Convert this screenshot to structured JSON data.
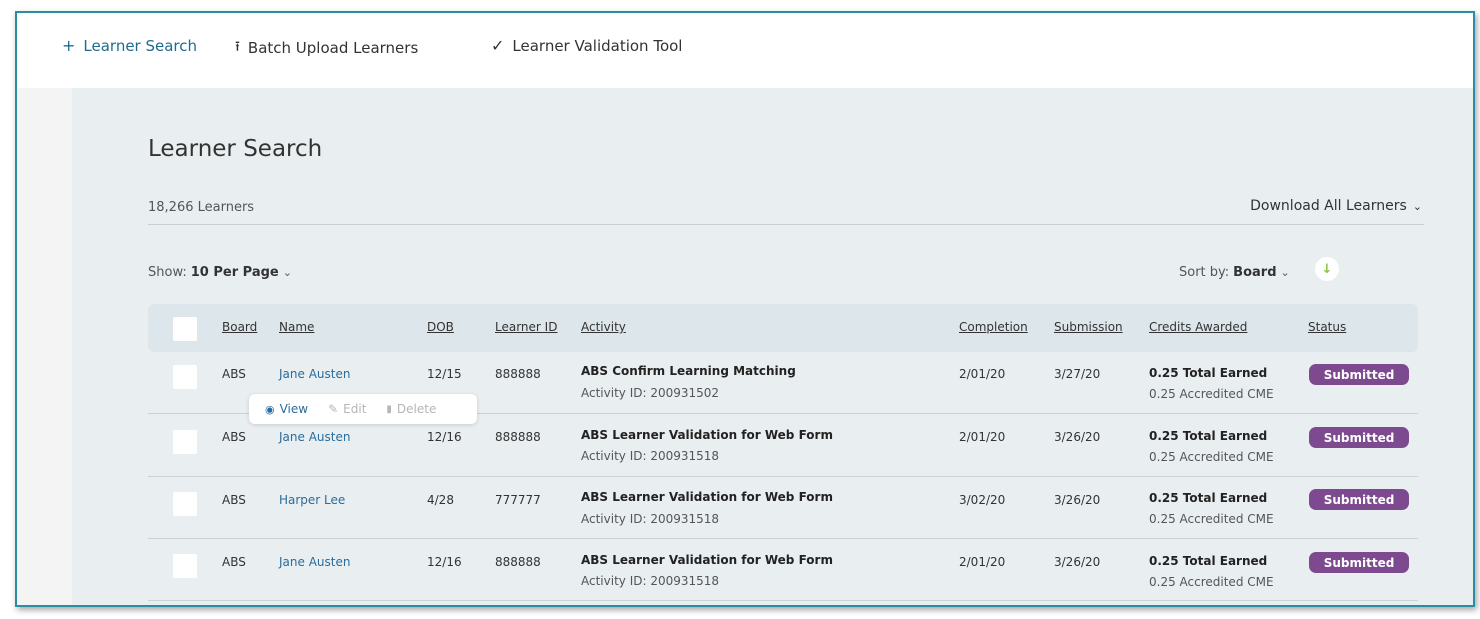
{
  "nav": {
    "learner_search": "Learner Search",
    "batch_upload": "Batch Upload Learners",
    "validation_tool": "Learner Validation Tool"
  },
  "page": {
    "title": "Learner Search",
    "count": "18,266 Learners",
    "download": "Download All Learners"
  },
  "controls": {
    "show_label": "Show:",
    "show_value": "10 Per Page",
    "sort_label": "Sort by:",
    "sort_value": "Board"
  },
  "columns": {
    "board": "Board",
    "name": "Name",
    "dob": "DOB",
    "learner_id": "Learner ID",
    "activity": "Activity",
    "completion": "Completion",
    "submission": "Submission",
    "credits": "Credits Awarded",
    "status": "Status"
  },
  "rows": [
    {
      "board": "ABS",
      "name": "Jane Austen",
      "dob": "12/15",
      "learner_id": "888888",
      "activity": "ABS Confirm Learning Matching",
      "activity_id": "Activity ID: 200931502",
      "completion": "2/01/20",
      "submission": "3/27/20",
      "credit_total": "0.25 Total Earned",
      "credit_acc": "0.25 Accredited CME",
      "status": "Submitted"
    },
    {
      "board": "ABS",
      "name": "Jane Austen",
      "dob": "12/16",
      "learner_id": "888888",
      "activity": "ABS Learner Validation for Web Form",
      "activity_id": "Activity ID: 200931518",
      "completion": "2/01/20",
      "submission": "3/26/20",
      "credit_total": "0.25 Total Earned",
      "credit_acc": "0.25 Accredited CME",
      "status": "Submitted"
    },
    {
      "board": "ABS",
      "name": "Harper Lee",
      "dob": "4/28",
      "learner_id": "777777",
      "activity": "ABS Learner Validation for Web Form",
      "activity_id": "Activity ID: 200931518",
      "completion": "3/02/20",
      "submission": "3/26/20",
      "credit_total": "0.25 Total Earned",
      "credit_acc": "0.25 Accredited CME",
      "status": "Submitted"
    },
    {
      "board": "ABS",
      "name": "Jane Austen",
      "dob": "12/16",
      "learner_id": "888888",
      "activity": "ABS Learner Validation for Web Form",
      "activity_id": "Activity ID: 200931518",
      "completion": "2/01/20",
      "submission": "3/26/20",
      "credit_total": "0.25 Total Earned",
      "credit_acc": "0.25 Accredited CME",
      "status": "Submitted"
    }
  ],
  "row_actions": {
    "view": "View",
    "edit": "Edit",
    "delete": "Delete"
  },
  "colors": {
    "accent": "#2a6c9c",
    "frame_border": "#2a8ea3",
    "status_badge": "#7d4a8f",
    "content_bg": "#e9eff1"
  }
}
